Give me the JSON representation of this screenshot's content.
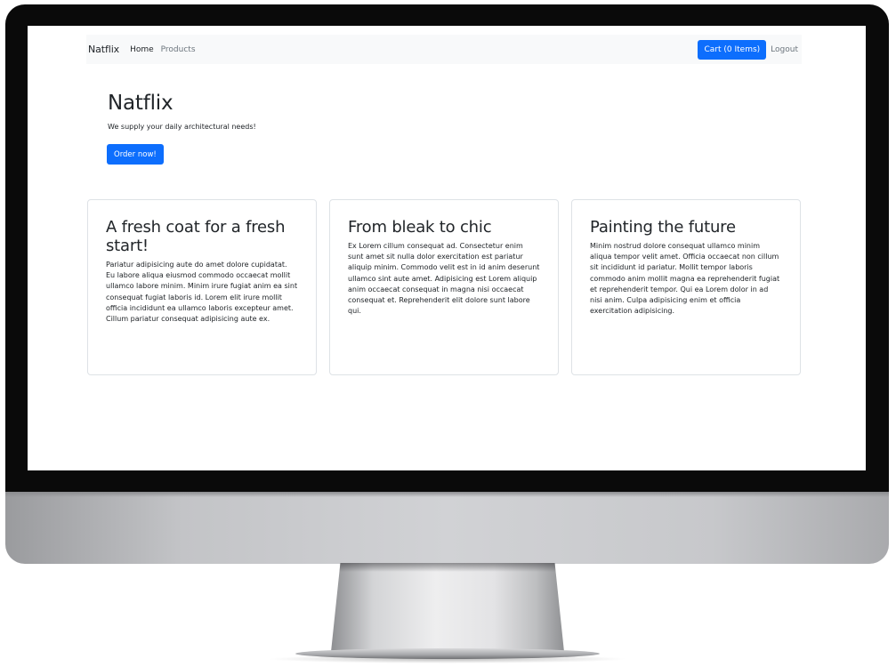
{
  "nav": {
    "brand": "Natflix",
    "links": [
      "Home",
      "Products"
    ],
    "cart_label": "Cart (0 Items)",
    "logout_label": "Logout"
  },
  "hero": {
    "title": "Natflix",
    "subtitle": "We supply your daily architectural needs!",
    "button_label": "Order now!"
  },
  "cards": [
    {
      "title": "A fresh coat for a fresh start!",
      "body": "Pariatur adipisicing aute do amet dolore cupidatat. Eu labore aliqua eiusmod commodo occaecat mollit ullamco labore minim. Minim irure fugiat anim ea sint consequat fugiat laboris id. Lorem elit irure mollit officia incididunt ea ullamco laboris excepteur amet. Cillum pariatur consequat adipisicing aute ex."
    },
    {
      "title": "From bleak to chic",
      "body": "Ex Lorem cillum consequat ad. Consectetur enim sunt amet sit nulla dolor exercitation est pariatur aliquip minim. Commodo velit est in id anim deserunt ullamco sint aute amet. Adipisicing est Lorem aliquip anim occaecat consequat in magna nisi occaecat consequat et. Reprehenderit elit dolore sunt labore qui."
    },
    {
      "title": "Painting the future",
      "body": "Minim nostrud dolore consequat ullamco minim aliqua tempor velit amet. Officia occaecat non cillum sit incididunt id pariatur. Mollit tempor laboris commodo anim mollit magna ea reprehenderit fugiat et reprehenderit tempor. Qui ea Lorem dolor in ad nisi anim. Culpa adipisicing enim et officia exercitation adipisicing."
    }
  ],
  "colors": {
    "primary": "#0d6efd",
    "navbar_bg": "#f8f9fa",
    "text": "#212529",
    "muted": "#6c757d"
  }
}
